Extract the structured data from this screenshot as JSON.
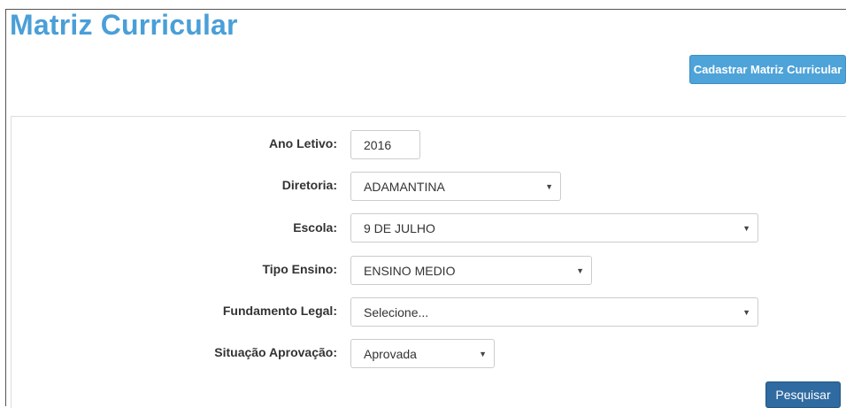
{
  "header": {
    "title": "Matriz Curricular",
    "register_button": "Cadastrar Matriz Curricular"
  },
  "form": {
    "ano_letivo": {
      "label": "Ano Letivo:",
      "value": "2016"
    },
    "diretoria": {
      "label": "Diretoria:",
      "value": "ADAMANTINA"
    },
    "escola": {
      "label": "Escola:",
      "value": "9 DE JULHO"
    },
    "tipo_ensino": {
      "label": "Tipo Ensino:",
      "value": "ENSINO MEDIO"
    },
    "fundamento_legal": {
      "label": "Fundamento Legal:",
      "value": "Selecione..."
    },
    "situacao_aprovacao": {
      "label": "Situação Aprovação:",
      "value": "Aprovada"
    },
    "search_button": "Pesquisar"
  },
  "icons": {
    "select_caret": "chevron-down-icon"
  },
  "colors": {
    "title": "#4a9fd8",
    "register_button": "#4ea3d9",
    "search_button": "#2f6aa0"
  }
}
